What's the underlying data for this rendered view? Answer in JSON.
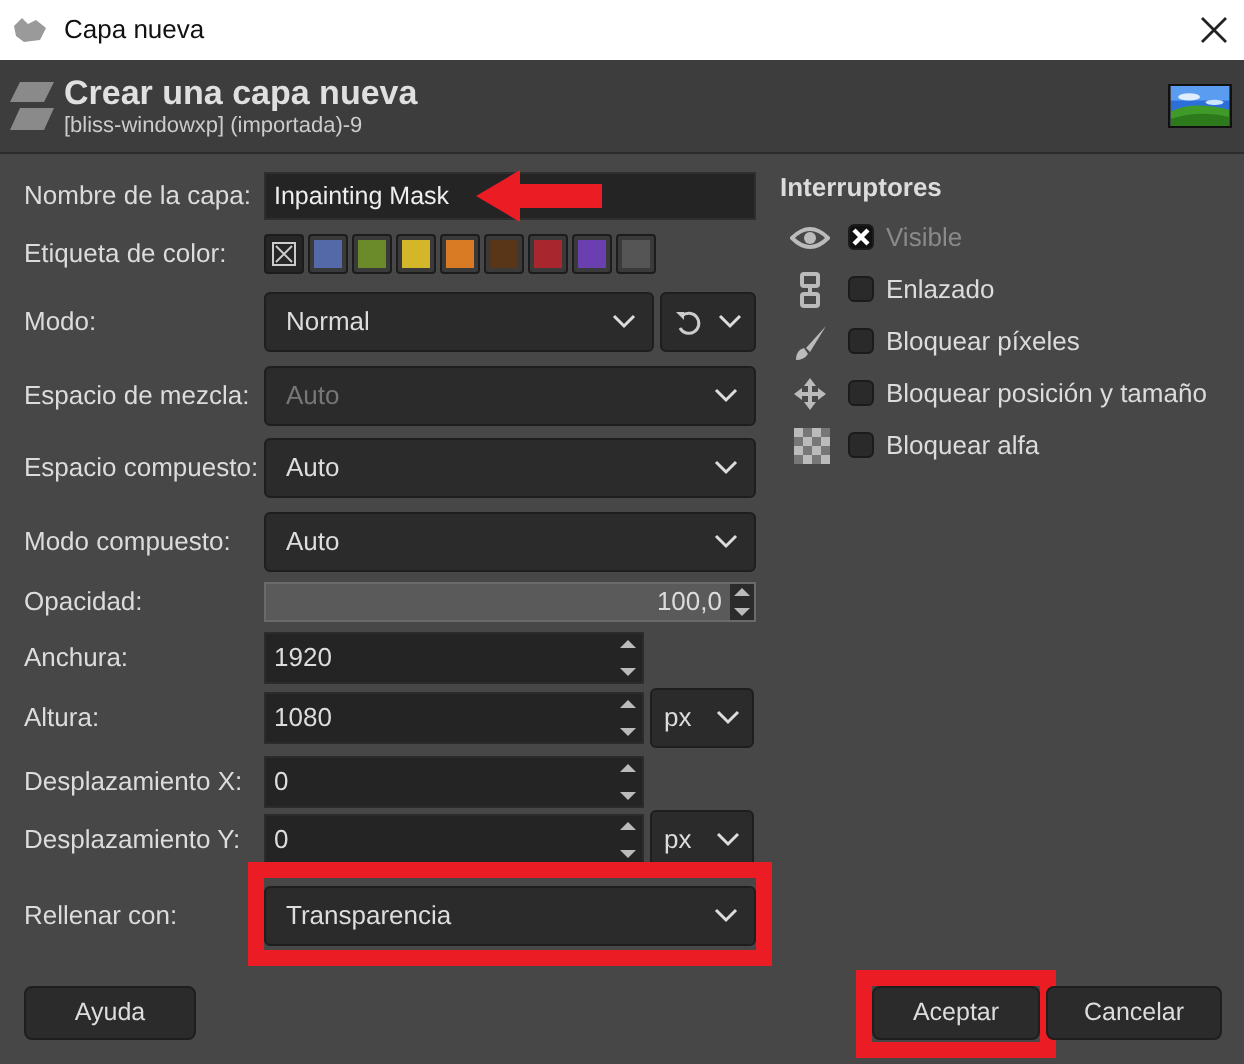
{
  "window": {
    "title": "Capa nueva"
  },
  "header": {
    "title": "Crear una capa nueva",
    "subtitle": "[bliss-windowxp] (importada)-9"
  },
  "fields": [
    {
      "kind": "text",
      "label": "Nombre de la capa:",
      "value": "Inpainting Mask",
      "pointer_arrow": true
    },
    {
      "kind": "color_tags",
      "label": "Etiqueta de color:",
      "tags": [
        {
          "kind": "none",
          "selected": true
        },
        {
          "kind": "color",
          "color": "#5469a8",
          "selected": false
        },
        {
          "kind": "color",
          "color": "#6b8a2a",
          "selected": false
        },
        {
          "kind": "color",
          "color": "#d4b62a",
          "selected": false
        },
        {
          "kind": "color",
          "color": "#d97a24",
          "selected": false
        },
        {
          "kind": "color",
          "color": "#5a3618",
          "selected": false
        },
        {
          "kind": "color",
          "color": "#a8262e",
          "selected": false
        },
        {
          "kind": "color",
          "color": "#6a3fb0",
          "selected": false
        },
        {
          "kind": "color",
          "color": "#555555",
          "selected": false
        }
      ]
    },
    {
      "kind": "mode",
      "label": "Modo:",
      "value": "Normal"
    },
    {
      "kind": "dropdown",
      "label": "Espacio de mezcla:",
      "value": "Auto",
      "disabled": true
    },
    {
      "kind": "dropdown",
      "label": "Espacio compuesto:",
      "value": "Auto",
      "disabled": false
    },
    {
      "kind": "dropdown",
      "label": "Modo compuesto:",
      "value": "Auto",
      "disabled": false
    },
    {
      "kind": "slider",
      "label": "Opacidad:",
      "value": "100,0",
      "level": 1.0
    },
    {
      "kind": "spin",
      "label": "Anchura:",
      "value": "1920"
    },
    {
      "kind": "spin",
      "label": "Altura:",
      "value": "1080",
      "unit": "px"
    },
    {
      "kind": "spin",
      "label": "Desplazamiento X:",
      "value": "0"
    },
    {
      "kind": "spin",
      "label": "Desplazamiento Y:",
      "value": "0",
      "unit": "px"
    },
    {
      "kind": "dropdown",
      "label": "Rellenar con:",
      "value": "Transparencia",
      "disabled": false,
      "highlighted": true
    }
  ],
  "switches": {
    "title": "Interruptores",
    "items": [
      {
        "kind": "visible",
        "label": "Visible",
        "checked": true,
        "disabled": true
      },
      {
        "kind": "linked",
        "label": "Enlazado",
        "checked": false,
        "disabled": false
      },
      {
        "kind": "lock_pixels",
        "label": "Bloquear píxeles",
        "checked": false,
        "disabled": false
      },
      {
        "kind": "lock_position",
        "label": "Bloquear posición y tamaño",
        "checked": false,
        "disabled": false
      },
      {
        "kind": "lock_alpha",
        "label": "Bloquear alfa",
        "checked": false,
        "disabled": false
      }
    ]
  },
  "buttons": [
    {
      "kind": "help",
      "label": "Ayuda",
      "highlighted": false
    },
    {
      "kind": "ok",
      "label": "Aceptar",
      "highlighted": true
    },
    {
      "kind": "cancel",
      "label": "Cancelar",
      "highlighted": false
    }
  ]
}
